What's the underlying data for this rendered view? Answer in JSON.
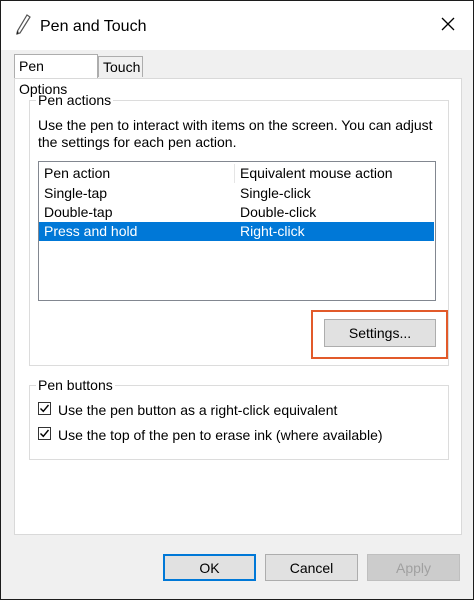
{
  "window": {
    "title": "Pen and Touch",
    "icon": "pen-icon",
    "close_icon": "close-icon"
  },
  "tabs": [
    {
      "label": "Pen Options",
      "active": true
    },
    {
      "label": "Touch",
      "active": false
    }
  ],
  "pen_actions": {
    "group_title": "Pen actions",
    "description_line1": "Use the pen to interact with items on the screen.  You can adjust",
    "description_line2": "the settings for each pen action.",
    "columns": [
      "Pen action",
      "Equivalent mouse action"
    ],
    "rows": [
      {
        "action": "Single-tap",
        "mouse": "Single-click",
        "selected": false
      },
      {
        "action": "Double-tap",
        "mouse": "Double-click",
        "selected": false
      },
      {
        "action": "Press and hold",
        "mouse": "Right-click",
        "selected": true
      }
    ],
    "settings_button": "Settings..."
  },
  "pen_buttons": {
    "group_title": "Pen buttons",
    "options": [
      {
        "label": "Use the pen button as a right-click equivalent",
        "checked": true
      },
      {
        "label": "Use the top of the pen to erase ink (where available)",
        "checked": true
      }
    ]
  },
  "footer": {
    "ok": "OK",
    "cancel": "Cancel",
    "apply": "Apply"
  },
  "colors": {
    "selection": "#0078d7",
    "highlight": "#e25a2a"
  }
}
